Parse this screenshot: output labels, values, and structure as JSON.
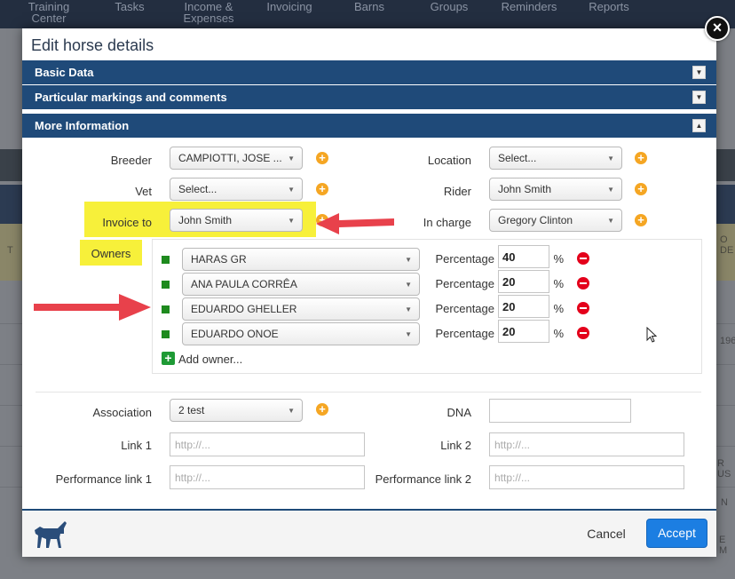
{
  "nav": {
    "items": [
      "Training\nCenter",
      "Tasks",
      "Income &\nExpenses",
      "Invoicing",
      "Barns",
      "Groups",
      "Reminders",
      "Reports"
    ]
  },
  "background": {
    "col_header_fragment": "O DE",
    "row_fragment_1": "196",
    "row_fragment_2": "R US",
    "row_fragment_3": "N",
    "row_fragment_4": "E M",
    "left_fragment": "T"
  },
  "modal": {
    "title": "Edit horse details",
    "close_glyph": "×"
  },
  "sections": {
    "basic": "Basic Data",
    "markings": "Particular markings and comments",
    "more": "More Information",
    "collapsed_glyph": "▼",
    "expanded_glyph": "▲"
  },
  "form": {
    "breeder_label": "Breeder",
    "breeder_value": "CAMPIOTTI, JOSE ...",
    "location_label": "Location",
    "location_value": "Select...",
    "vet_label": "Vet",
    "vet_value": "Select...",
    "rider_label": "Rider",
    "rider_value": "John Smith",
    "invoice_label": "Invoice to",
    "invoice_value": "John Smith",
    "in_charge_label": "In charge",
    "in_charge_value": "Gregory Clinton",
    "owners_label": "Owners",
    "percentage_label": "Percentage",
    "percent_sign": "%",
    "add_owner": "Add owner...",
    "association_label": "Association",
    "association_value": "2 test",
    "dna_label": "DNA",
    "link1_label": "Link 1",
    "link1_placeholder": "http://...",
    "link2_label": "Link 2",
    "link2_placeholder": "http://...",
    "perf1_label": "Performance link 1",
    "perf1_placeholder": "http://...",
    "perf2_label": "Performance link 2",
    "perf2_placeholder": "http://..."
  },
  "owners": [
    {
      "name": "HARAS GR",
      "percentage": "40"
    },
    {
      "name": "ANA PAULA CORRÊA",
      "percentage": "20"
    },
    {
      "name": "EDUARDO GHELLER",
      "percentage": "20"
    },
    {
      "name": "EDUARDO ONOE",
      "percentage": "20"
    }
  ],
  "footer": {
    "cancel": "Cancel",
    "accept": "Accept"
  },
  "icons": {
    "plus": "add-icon",
    "minus": "remove-icon",
    "horse": "horse-icon",
    "arrow": "red-arrow-annotation"
  },
  "colors": {
    "section_bar": "#1f4a79",
    "accent_button": "#1c7ee2",
    "highlight": "#f7f03a",
    "add_orange": "#f5a623",
    "remove_red": "#e4001b",
    "owner_green": "#1e8a1e",
    "arrow_red": "#e8414b"
  }
}
